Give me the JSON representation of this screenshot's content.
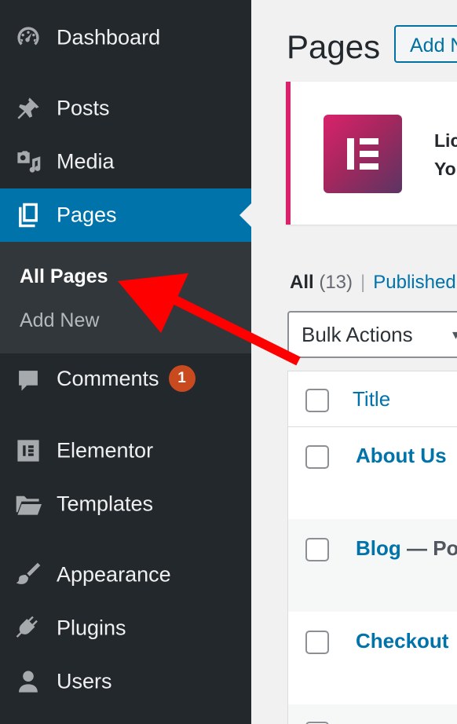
{
  "sidebar": {
    "items": [
      {
        "key": "dashboard",
        "label": "Dashboard",
        "icon": "dashboard-icon"
      },
      {
        "key": "posts",
        "label": "Posts",
        "icon": "pushpin-icon"
      },
      {
        "key": "media",
        "label": "Media",
        "icon": "media-icon"
      },
      {
        "key": "pages",
        "label": "Pages",
        "icon": "pages-icon",
        "active": true
      },
      {
        "key": "comments",
        "label": "Comments",
        "icon": "comment-icon",
        "badge": "1"
      },
      {
        "key": "elementor",
        "label": "Elementor",
        "icon": "elementor-icon"
      },
      {
        "key": "templates",
        "label": "Templates",
        "icon": "folder-icon"
      },
      {
        "key": "appearance",
        "label": "Appearance",
        "icon": "paintbrush-icon"
      },
      {
        "key": "plugins",
        "label": "Plugins",
        "icon": "plug-icon"
      },
      {
        "key": "users",
        "label": "Users",
        "icon": "user-icon"
      }
    ],
    "submenu": [
      {
        "label": "All Pages",
        "current": true
      },
      {
        "label": "Add New",
        "current": false
      }
    ]
  },
  "main": {
    "title": "Pages",
    "add_new": "Add New",
    "notice": {
      "line1": "Lic",
      "line2": "Yo"
    },
    "filters": {
      "all": "All",
      "all_count": "(13)",
      "separator": "|",
      "published": "Published"
    },
    "bulk_actions": "Bulk Actions",
    "table": {
      "column_title": "Title",
      "rows": [
        {
          "title": "About Us",
          "state": ""
        },
        {
          "title": "Blog",
          "state": " — Po"
        },
        {
          "title": "Checkout",
          "state": ""
        }
      ]
    }
  },
  "colors": {
    "sidebar_bg": "#23282d",
    "submenu_bg": "#32373c",
    "active_bg": "#0073aa",
    "link": "#0073aa",
    "badge": "#ca4a1f",
    "arrow": "#ff0000",
    "elementor_brand": "#d9226b"
  }
}
